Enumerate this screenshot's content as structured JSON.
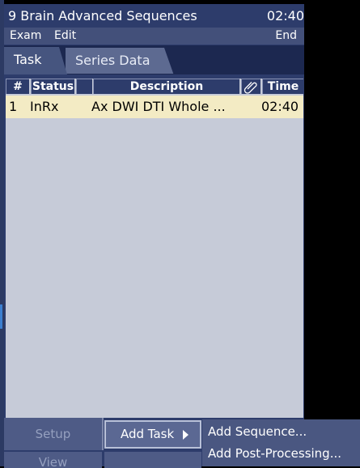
{
  "titlebar": {
    "title": "9 Brain Advanced Sequences",
    "clock": "02:40"
  },
  "menu": {
    "exam": "Exam",
    "edit": "Edit",
    "end": "End"
  },
  "tabs": [
    {
      "label": "Task",
      "active": true
    },
    {
      "label": "Series Data",
      "active": false
    }
  ],
  "table": {
    "columns": [
      "#",
      "Status",
      "",
      "Description",
      "paperclip-icon",
      "Time"
    ],
    "rows": [
      {
        "num": "1",
        "status": "InRx",
        "description": "Ax DWI DTI Whole ...",
        "time": "02:40"
      }
    ]
  },
  "buttons": {
    "setup": "Setup",
    "view": "View",
    "add_task": "Add Task"
  },
  "submenu": {
    "items": [
      "Add Sequence...",
      "Add Post-Processing..."
    ]
  },
  "colors": {
    "panel": "#2d3c6b",
    "selected_row": "#f3ebc4",
    "grid_bg": "#c6cbd8"
  }
}
